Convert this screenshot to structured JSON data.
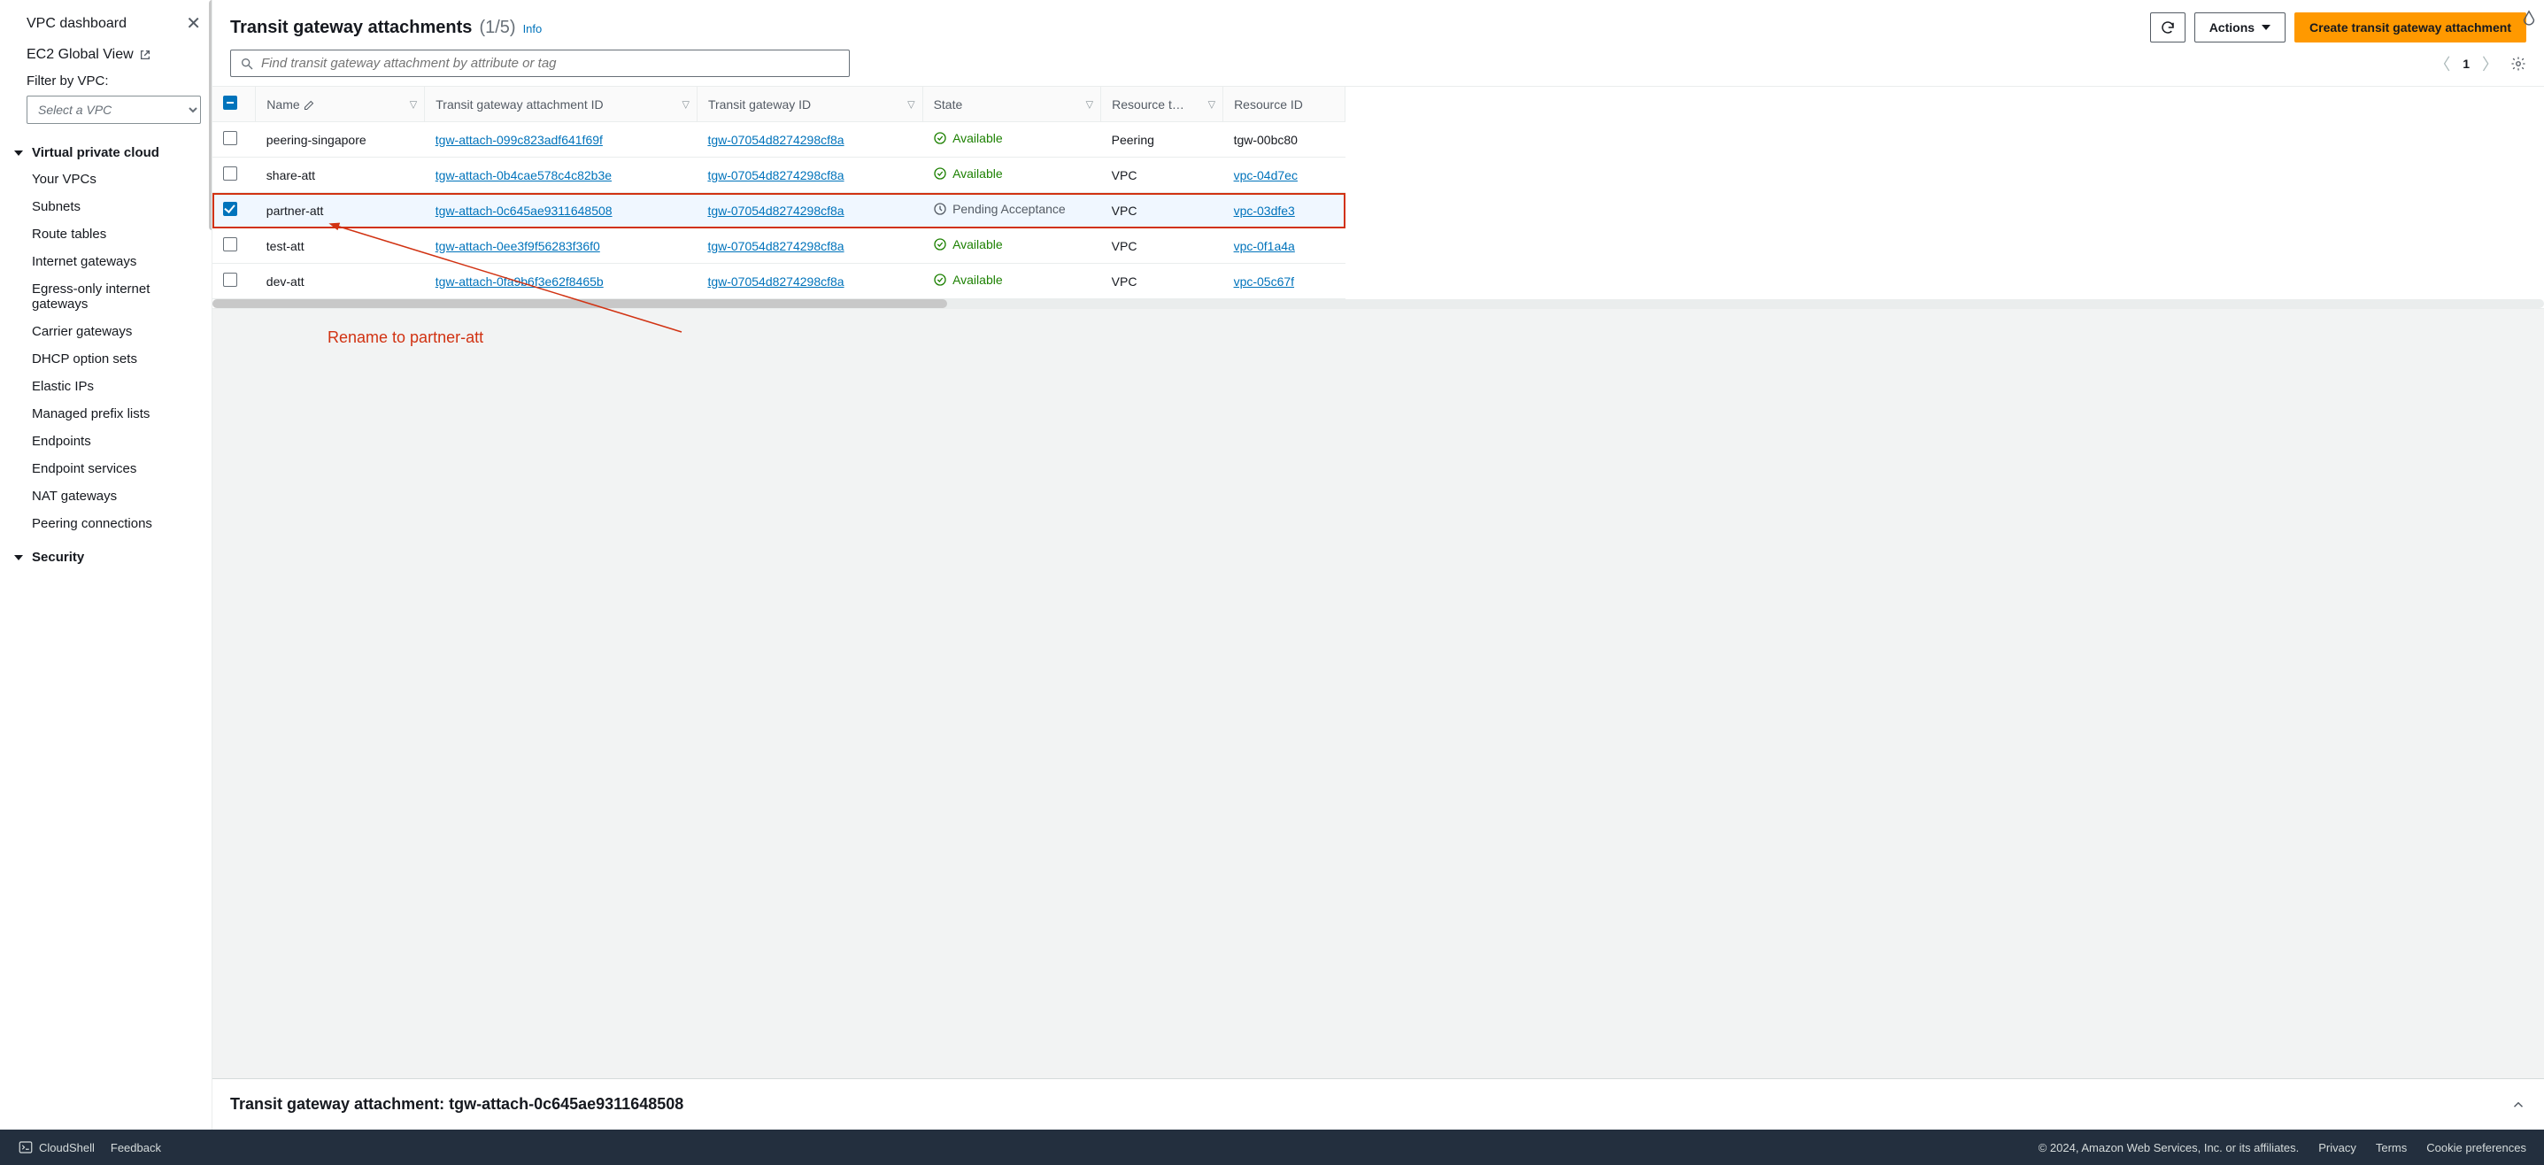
{
  "sidebar": {
    "dashboard": "VPC dashboard",
    "globalView": "EC2 Global View",
    "filterLabel": "Filter by VPC:",
    "filterPlaceholder": "Select a VPC",
    "sectionVpc": "Virtual private cloud",
    "items": [
      "Your VPCs",
      "Subnets",
      "Route tables",
      "Internet gateways",
      "Egress-only internet gateways",
      "Carrier gateways",
      "DHCP option sets",
      "Elastic IPs",
      "Managed prefix lists",
      "Endpoints",
      "Endpoint services",
      "NAT gateways",
      "Peering connections"
    ],
    "sectionSecurity": "Security"
  },
  "header": {
    "title": "Transit gateway attachments",
    "count": "(1/5)",
    "info": "Info",
    "actions": "Actions",
    "create": "Create transit gateway attachment"
  },
  "search": {
    "placeholder": "Find transit gateway attachment by attribute or tag"
  },
  "pager": {
    "page": "1"
  },
  "columns": {
    "name": "Name",
    "attachId": "Transit gateway attachment ID",
    "tgwId": "Transit gateway ID",
    "state": "State",
    "resType": "Resource t…",
    "resId": "Resource ID"
  },
  "states": {
    "available": "Available",
    "pending": "Pending Acceptance"
  },
  "rows": [
    {
      "name": "peering-singapore",
      "attach": "tgw-attach-099c823adf641f69f",
      "tgw": "tgw-07054d8274298cf8a",
      "state": "available",
      "resType": "Peering",
      "resId": "tgw-00bc80",
      "selected": false
    },
    {
      "name": "share-att",
      "attach": "tgw-attach-0b4cae578c4c82b3e",
      "tgw": "tgw-07054d8274298cf8a",
      "state": "available",
      "resType": "VPC",
      "resId": "vpc-04d7ec",
      "selected": false
    },
    {
      "name": "partner-att",
      "attach": "tgw-attach-0c645ae9311648508",
      "tgw": "tgw-07054d8274298cf8a",
      "state": "pending",
      "resType": "VPC",
      "resId": "vpc-03dfe3",
      "selected": true,
      "highlight": true
    },
    {
      "name": "test-att",
      "attach": "tgw-attach-0ee3f9f56283f36f0",
      "tgw": "tgw-07054d8274298cf8a",
      "state": "available",
      "resType": "VPC",
      "resId": "vpc-0f1a4a",
      "selected": false
    },
    {
      "name": "dev-att",
      "attach": "tgw-attach-0fa9b6f3e62f8465b",
      "tgw": "tgw-07054d8274298cf8a",
      "state": "available",
      "resType": "VPC",
      "resId": "vpc-05c67f",
      "selected": false
    }
  ],
  "annotation": "Rename to partner-att",
  "details": {
    "prefix": "Transit gateway attachment: ",
    "id": "tgw-attach-0c645ae9311648508"
  },
  "footer": {
    "cloudshell": "CloudShell",
    "feedback": "Feedback",
    "copyright": "© 2024, Amazon Web Services, Inc. or its affiliates.",
    "privacy": "Privacy",
    "terms": "Terms",
    "cookies": "Cookie preferences"
  }
}
